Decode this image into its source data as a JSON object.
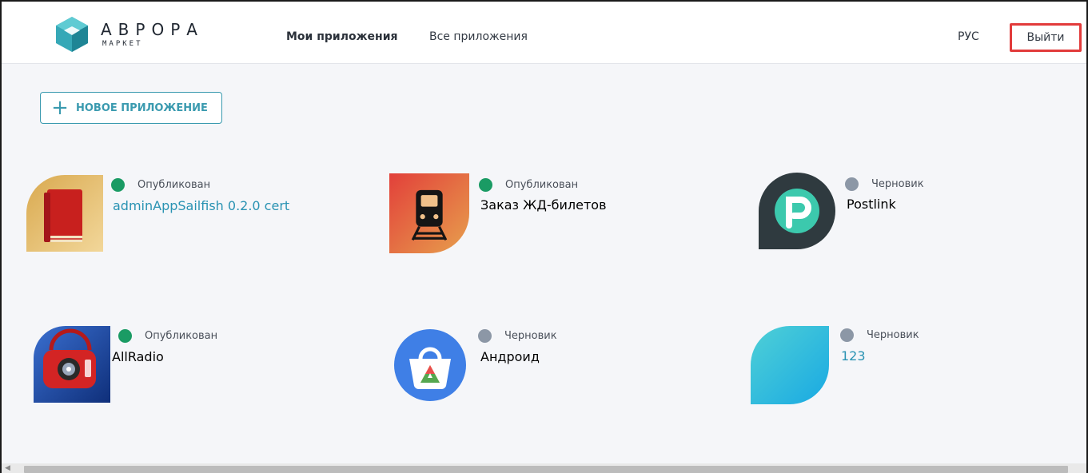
{
  "brand": {
    "title": "АВРОРА",
    "subtitle": "МАРКЕТ",
    "accent_color": "#3a9aaf"
  },
  "nav": {
    "items": [
      {
        "label": "Мои приложения",
        "active": true
      },
      {
        "label": "Все приложения",
        "active": false
      }
    ],
    "language": "РУС",
    "logout_label": "Выйти"
  },
  "actions": {
    "new_app_icon": "plus-icon",
    "new_app_label": "НОВОЕ ПРИЛОЖЕНИЕ"
  },
  "apps": [
    {
      "name": "adminAppSailfish 0.2.0 cert",
      "status": "Опубликован",
      "status_color": "#1a9b64",
      "name_color": "#2a93b3",
      "icon": "book-icon"
    },
    {
      "name": "Заказ ЖД-билетов",
      "status": "Опубликован",
      "status_color": "#1a9b64",
      "name_color": "#3b424c",
      "icon": "train-icon"
    },
    {
      "name": "Postlink",
      "status": "Черновик",
      "status_color": "#8c97a6",
      "name_color": "#3b424c",
      "icon": "postlink-icon"
    },
    {
      "name": "AllRadio",
      "status": "Опубликован",
      "status_color": "#1a9b64",
      "name_color": "#3b424c",
      "icon": "radio-icon"
    },
    {
      "name": "Андроид",
      "status": "Черновик",
      "status_color": "#8c97a6",
      "name_color": "#3b424c",
      "icon": "android-store-icon"
    },
    {
      "name": "123",
      "status": "Черновик",
      "status_color": "#8c97a6",
      "name_color": "#2a93b3",
      "icon": "blank-app-icon"
    }
  ]
}
